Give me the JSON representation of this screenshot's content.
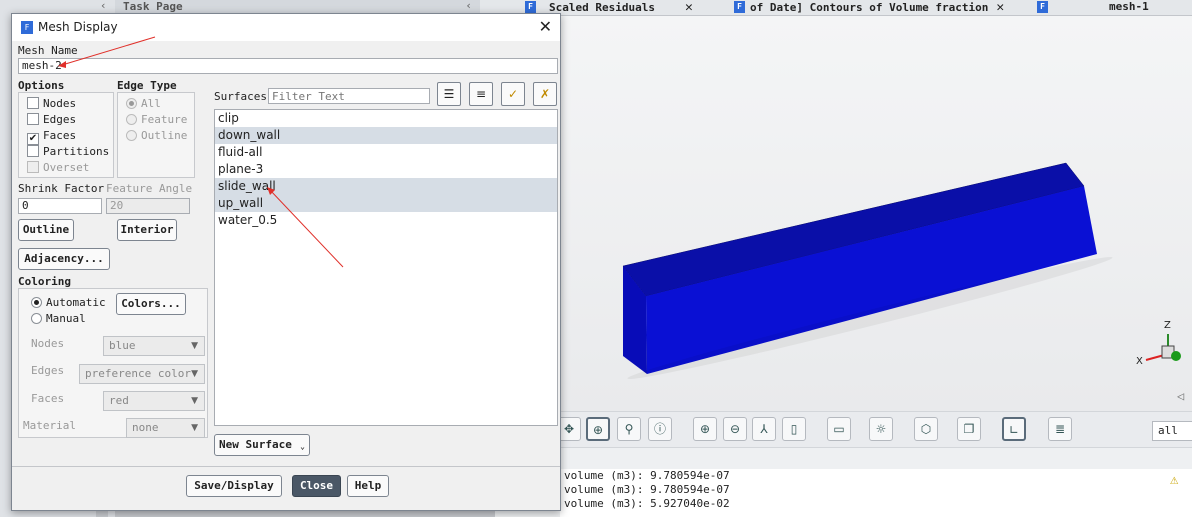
{
  "background": {
    "task_page_label": "Task Page",
    "tabs": [
      {
        "label": "Scaled Residuals",
        "close": "✕"
      },
      {
        "label": "of Date] Contours of Volume fraction",
        "close": "✕"
      },
      {
        "label": "mesh-1",
        "close": ""
      }
    ],
    "toolbar_select_value": "all",
    "console_lines": [
      "volume (m3): 9.780594e-07",
      "volume (m3): 9.780594e-07",
      "volume (m3): 5.927040e-02"
    ],
    "axis_labels": {
      "z": "Z",
      "x": "X"
    },
    "box_color": "#0a10d4",
    "box_top_color": "#0a0fa8"
  },
  "dialog": {
    "title": "Mesh Display",
    "mesh_name_label": "Mesh Name",
    "mesh_name_value": "mesh-2",
    "options_label": "Options",
    "options": [
      {
        "label": "Nodes",
        "checked": false
      },
      {
        "label": "Edges",
        "checked": false
      },
      {
        "label": "Faces",
        "checked": true
      },
      {
        "label": "Partitions",
        "checked": false
      },
      {
        "label": "Overset",
        "checked": false,
        "disabled": true
      }
    ],
    "edge_type_label": "Edge Type",
    "edge_types": [
      {
        "label": "All",
        "selected": true
      },
      {
        "label": "Feature",
        "selected": false
      },
      {
        "label": "Outline",
        "selected": false
      }
    ],
    "shrink_factor_label": "Shrink Factor",
    "shrink_factor_value": "0",
    "feature_angle_label": "Feature Angle",
    "feature_angle_value": "20",
    "outline_button": "Outline",
    "interior_button": "Interior",
    "adjacency_button": "Adjacency...",
    "coloring_label": "Coloring",
    "coloring_modes": [
      {
        "label": "Automatic",
        "selected": true
      },
      {
        "label": "Manual",
        "selected": false
      }
    ],
    "colors_button": "Colors...",
    "color_rows": [
      {
        "label": "Nodes",
        "value": "blue"
      },
      {
        "label": "Edges",
        "value": "preference color"
      },
      {
        "label": "Faces",
        "value": "red"
      },
      {
        "label": "Material",
        "value": "none"
      }
    ],
    "surfaces_label": "Surfaces",
    "filter_placeholder": "Filter Text",
    "surfaces": [
      {
        "name": "clip",
        "selected": false
      },
      {
        "name": "down_wall",
        "selected": true
      },
      {
        "name": "fluid-all",
        "selected": false
      },
      {
        "name": "plane-3",
        "selected": false
      },
      {
        "name": "slide_wall",
        "selected": true
      },
      {
        "name": "up_wall",
        "selected": true
      },
      {
        "name": "water_0.5",
        "selected": false
      }
    ],
    "new_surface_button": "New Surface",
    "save_display_button": "Save/Display",
    "close_button": "Close",
    "help_button": "Help"
  }
}
